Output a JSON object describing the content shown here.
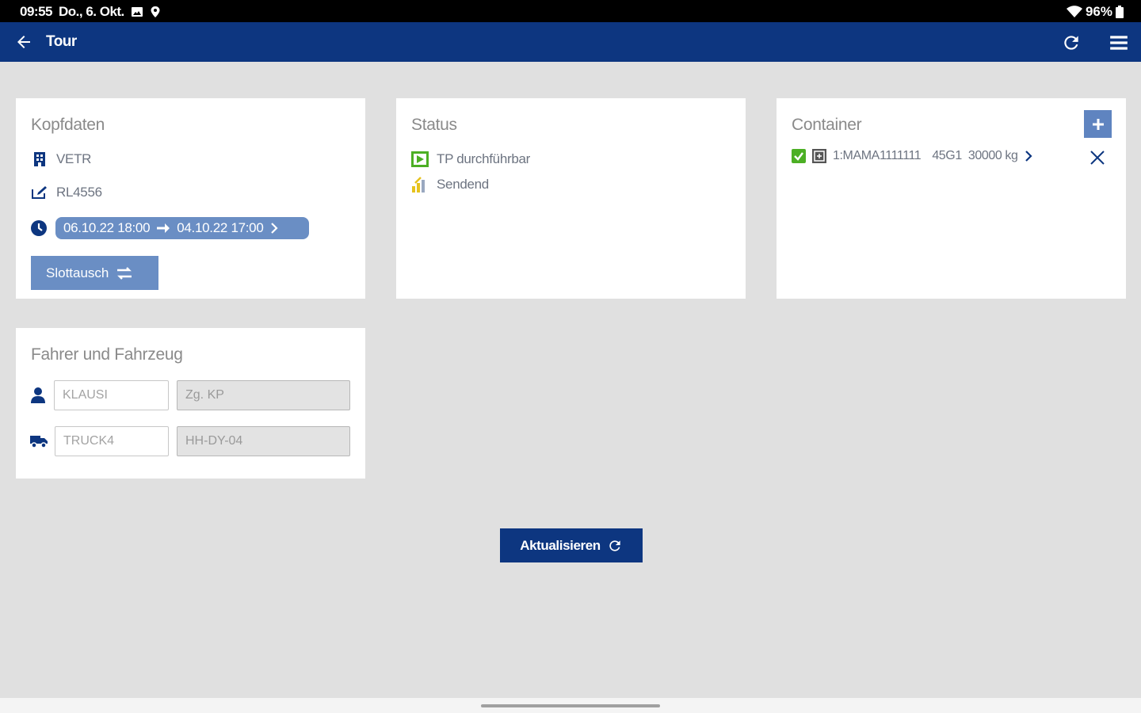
{
  "statusbar": {
    "time": "09:55",
    "date": "Do., 6. Okt.",
    "battery": "96%"
  },
  "appbar": {
    "title": "Tour",
    "icons": [
      "back-arrow-icon",
      "refresh-icon",
      "menu-icon"
    ]
  },
  "kopfdaten": {
    "title": "Kopfdaten",
    "company": "VETR",
    "reference": "RL4556",
    "date_from": "06.10.22 18:00",
    "date_to": "04.10.22 17:00",
    "slot_button": "Slottausch"
  },
  "status": {
    "title": "Status",
    "items": [
      {
        "label": "TP durchführbar",
        "icon": "play-flag-icon"
      },
      {
        "label": "Sendend",
        "icon": "signal-icon"
      }
    ]
  },
  "container": {
    "title": "Container",
    "items": [
      {
        "id": "1:MAMA1111111",
        "type": "45G1",
        "weight": "30000 kg"
      }
    ]
  },
  "fahrer": {
    "title": "Fahrer und Fahrzeug",
    "driver_value": "KLAUSI",
    "driver_extra": "Zg. KP",
    "truck_value": "TRUCK4",
    "truck_plate": "HH-DY-04"
  },
  "actions": {
    "update_button": "Aktualisieren"
  },
  "colors": {
    "primary": "#0d3680",
    "accent": "#6a8ec4",
    "background": "#e0e0e0",
    "status_green": "#4caf24"
  }
}
